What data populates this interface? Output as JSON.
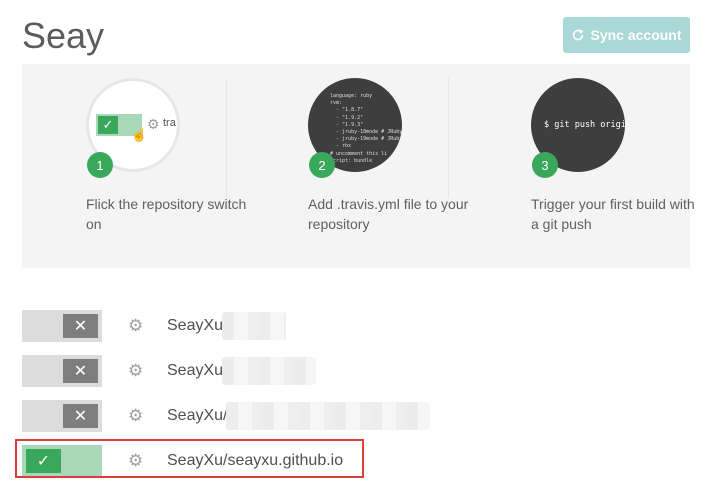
{
  "header": {
    "title": "Seay",
    "sync_label": "Sync account"
  },
  "steps": [
    {
      "number": "1",
      "text": "Flick the repository switch on",
      "illustration_text": "tra"
    },
    {
      "number": "2",
      "text": "Add .travis.yml file to your repository",
      "code": "language: ruby\nrvm:\n  - \"1.8.7\"\n  - \"1.9.2\"\n  - \"1.9.3\"\n  - jruby-18mode # JRuby\n  - jruby-19mode # JRuby\n  - rbx\n# uncomment this li\nscript: bundle"
    },
    {
      "number": "3",
      "text": "Trigger your first build with a git push",
      "command": "$ git push origin"
    }
  ],
  "repos": [
    {
      "name": "SeayXu",
      "enabled": false
    },
    {
      "name": "SeayXu",
      "enabled": false
    },
    {
      "name": "SeayXu/",
      "enabled": false
    },
    {
      "name": "SeayXu/seayxu.github.io",
      "enabled": true
    }
  ],
  "colors": {
    "accent_green": "#39a85b",
    "sync_button": "#a9d8d6",
    "highlight_border": "#d9403a"
  }
}
